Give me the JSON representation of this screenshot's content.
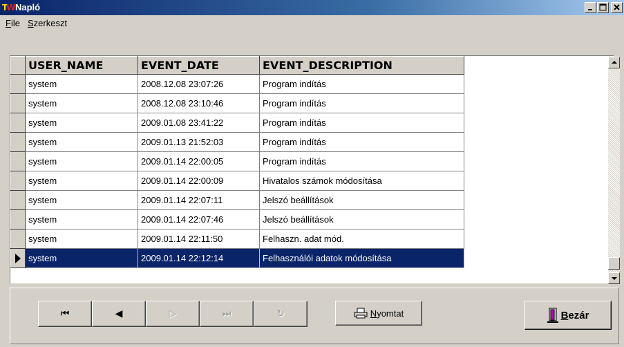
{
  "window": {
    "title": "Napló"
  },
  "menu": [
    {
      "label": "File",
      "accel": "F",
      "rest": "ile"
    },
    {
      "label": "Szerkeszt",
      "accel": "S",
      "rest": "zerkeszt"
    }
  ],
  "grid": {
    "columns": [
      "USER_NAME",
      "EVENT_DATE",
      "EVENT_DESCRIPTION"
    ],
    "rows": [
      [
        "system",
        "2008.12.08 23:07:26",
        "Program indítás"
      ],
      [
        "system",
        "2008.12.08 23:10:46",
        "Program indítás"
      ],
      [
        "system",
        "2009.01.08 23:41:22",
        "Program indítás"
      ],
      [
        "system",
        "2009.01.13 21:52:03",
        "Program indítás"
      ],
      [
        "system",
        "2009.01.14 22:00:05",
        "Program indítás"
      ],
      [
        "system",
        "2009.01.14 22:00:09",
        "Hivatalos számok módosítása"
      ],
      [
        "system",
        "2009.01.14 22:07:11",
        "Jelszó beállítások"
      ],
      [
        "system",
        "2009.01.14 22:07:46",
        "Jelszó beállítások"
      ],
      [
        "system",
        "2009.01.14 22:11:50",
        "Felhaszn. adat mód."
      ],
      [
        "system",
        "2009.01.14 22:12:14",
        "Felhasználói adatok módosítása"
      ]
    ],
    "selected_row": 9
  },
  "navigator": {
    "first": "⏮",
    "prior": "◀",
    "next": "▷",
    "last": "⏭",
    "refresh": "↻"
  },
  "buttons": {
    "print": {
      "accel": "N",
      "rest": "yomtat"
    },
    "close": {
      "accel": "B",
      "rest": "ezár"
    }
  },
  "colors": {
    "selection": "#0a246a",
    "titlebar": "#0a246a",
    "face": "#d4d0c8"
  }
}
